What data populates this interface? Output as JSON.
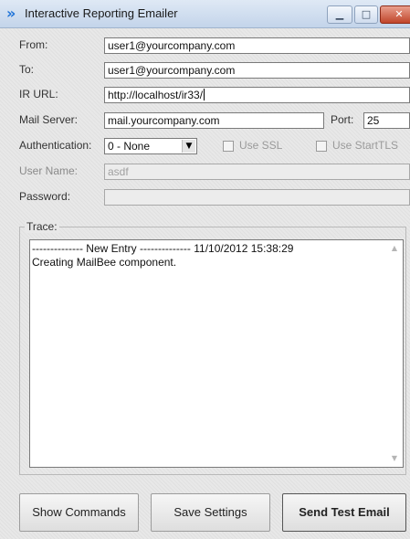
{
  "window": {
    "title": "Interactive Reporting Emailer",
    "icon": "double-chevron-right-icon",
    "controls": {
      "minimize": "minimize-icon",
      "maximize": "maximize-icon",
      "close": "close-icon"
    },
    "accent_color": "#1e73d8",
    "close_color": "#c0452b"
  },
  "form": {
    "from_label": "From:",
    "from_value": "user1@yourcompany.com",
    "to_label": "To:",
    "to_value": "user1@yourcompany.com",
    "ir_url_label": "IR URL:",
    "ir_url_value": "http://localhost/ir33/",
    "mail_server_label": "Mail Server:",
    "mail_server_value": "mail.yourcompany.com",
    "port_label": "Port:",
    "port_value": "25",
    "authentication_label": "Authentication:",
    "authentication_value": "0 - None",
    "use_ssl_label": "Use SSL",
    "use_starttls_label": "Use StartTLS",
    "username_label": "User Name:",
    "username_value": "asdf",
    "password_label": "Password:",
    "password_value": ""
  },
  "trace": {
    "legend": "Trace:",
    "lines": [
      "-------------- New Entry -------------- 11/10/2012 15:38:29",
      "Creating MailBee component."
    ]
  },
  "buttons": {
    "show_commands": "Show Commands",
    "save_settings": "Save Settings",
    "send_test_email": "Send Test Email"
  }
}
